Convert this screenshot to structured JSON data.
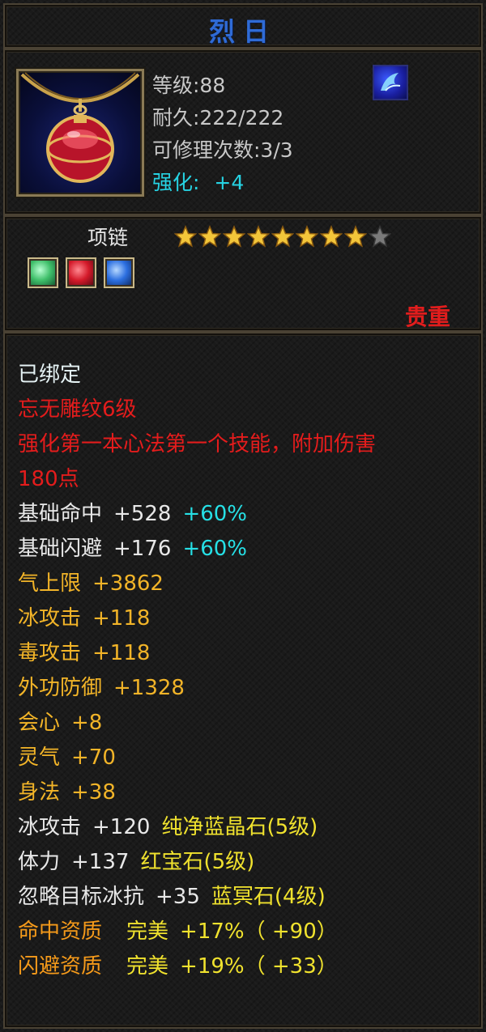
{
  "item": {
    "name": "烈日",
    "level": "等级:88",
    "durability": "耐久:222/222",
    "repair": "可修理次数:3/3",
    "enhance_label": "强化:",
    "enhance_value": "+4",
    "type": "项链",
    "stars_filled": 8,
    "stars_total": 9,
    "rarity": "贵重",
    "sockets": [
      {
        "name": "green-gem",
        "color": "#3fbf6a"
      },
      {
        "name": "red-gem",
        "color": "#d41a2a"
      },
      {
        "name": "blue-gem",
        "color": "#2c6fe0"
      }
    ]
  },
  "colors": {
    "title": "#2f6bd6",
    "red": "#e41c1c",
    "yellow": "#f0e22e",
    "cyan": "#26e0e6",
    "orange": "#f59a1a"
  },
  "attributes": {
    "bound": "已绑定",
    "engrave": "忘无雕纹6级",
    "engrave_desc_1": "强化第一本心法第一个技能，附加伤害",
    "engrave_desc_2": "180点",
    "stats": [
      {
        "label": "基础命中",
        "value": "+528",
        "bonus": "+60%"
      },
      {
        "label": "基础闪避",
        "value": "+176",
        "bonus": "+60%"
      },
      {
        "label": "气上限",
        "value": "+3862"
      },
      {
        "label": "冰攻击",
        "value": "+118"
      },
      {
        "label": "毒攻击",
        "value": "+118"
      },
      {
        "label": "外功防御",
        "value": "+1328"
      },
      {
        "label": "会心",
        "value": "+8"
      },
      {
        "label": "灵气",
        "value": "+70"
      },
      {
        "label": "身法",
        "value": "+38"
      }
    ],
    "gem_stats": [
      {
        "label": "冰攻击",
        "value": "+120",
        "gem": "纯净蓝晶石(5级)"
      },
      {
        "label": "体力",
        "value": "+137",
        "gem": "红宝石(5级)"
      },
      {
        "label": "忽略目标冰抗",
        "value": "+35",
        "gem": "蓝冥石(4级)"
      }
    ],
    "aptitudes": [
      {
        "label": "命中资质",
        "quality": "完美",
        "value": "+17%",
        "extra": "（ +90）"
      },
      {
        "label": "闪避资质",
        "quality": "完美",
        "value": "+19%",
        "extra": "（ +33）"
      }
    ]
  }
}
